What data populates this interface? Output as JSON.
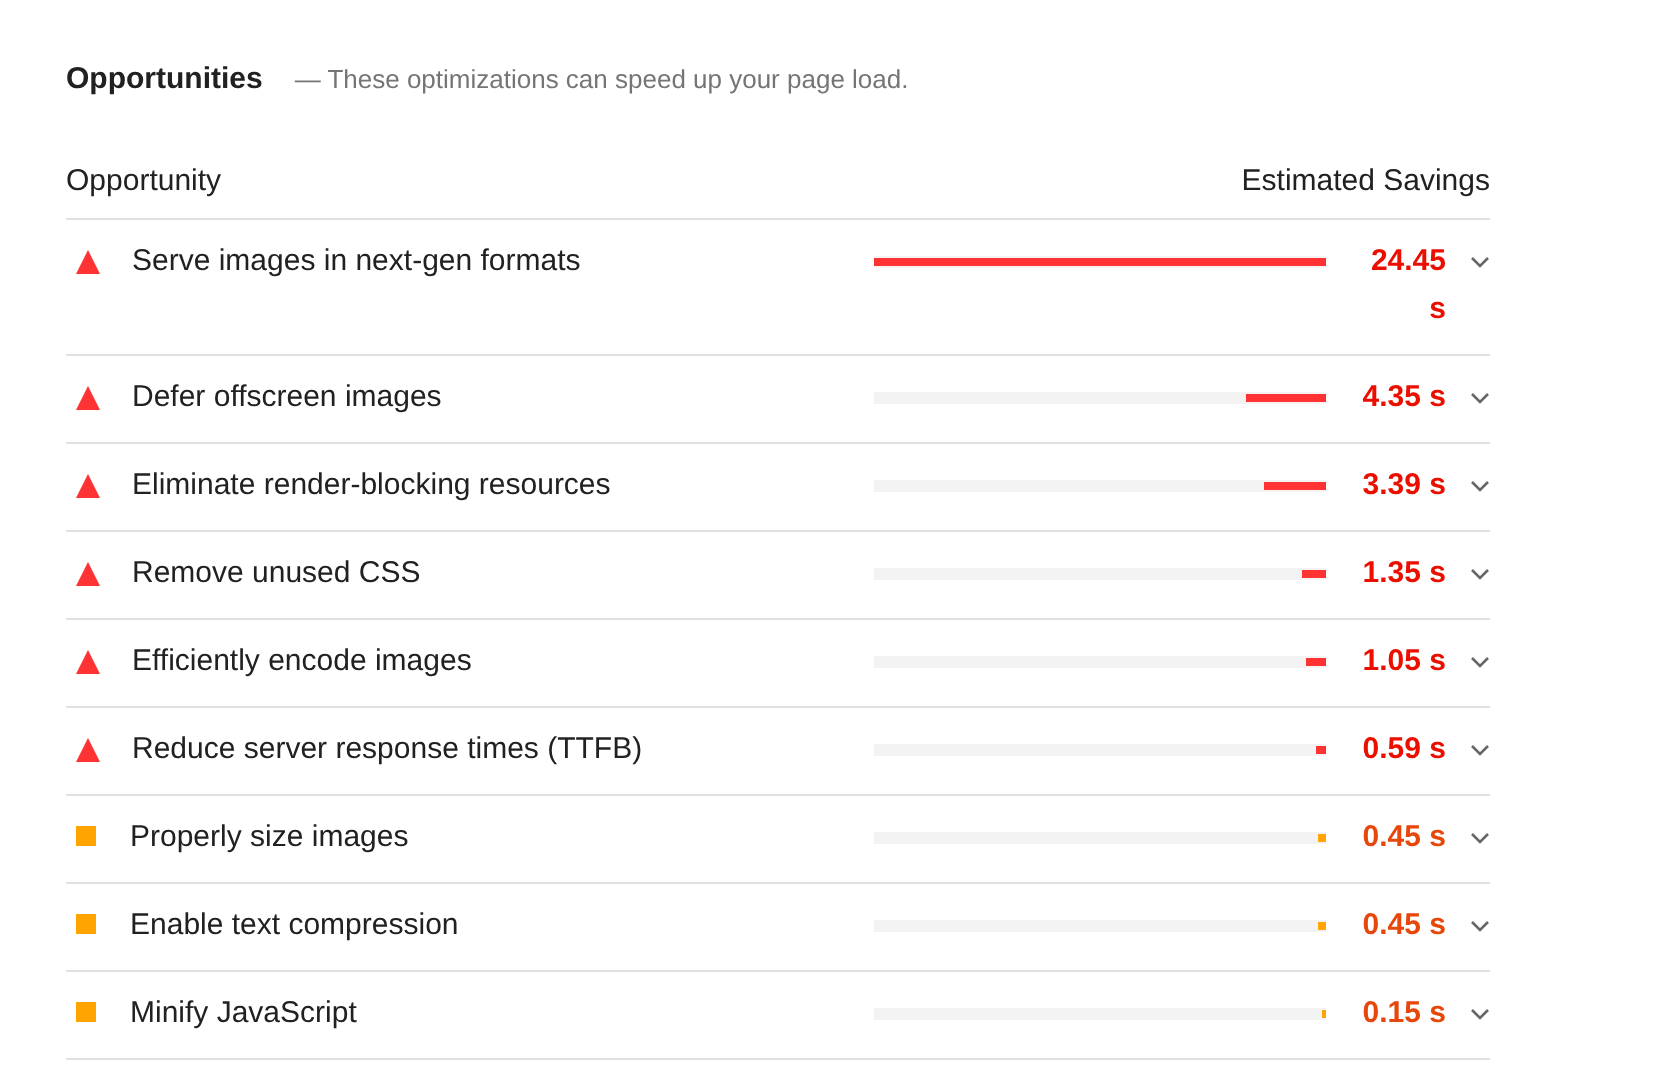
{
  "section": {
    "title": "Opportunities",
    "description": "— These optimizations can speed up your page load."
  },
  "table": {
    "columns": [
      "Opportunity",
      "Estimated Savings"
    ],
    "rows": [
      {
        "kind": "fail",
        "label": "Serve images in next-gen formats",
        "level": 1.0,
        "savings": "24.45 s"
      },
      {
        "kind": "fail",
        "label": "Defer offscreen images",
        "level": 0.178,
        "savings": "4.35 s"
      },
      {
        "kind": "fail",
        "label": "Eliminate render-blocking resources",
        "level": 0.139,
        "savings": "3.39 s"
      },
      {
        "kind": "fail",
        "label": "Remove unused CSS",
        "level": 0.055,
        "savings": "1.35 s"
      },
      {
        "kind": "fail",
        "label": "Efficiently encode images",
        "level": 0.043,
        "savings": "1.05 s"
      },
      {
        "kind": "fail",
        "label": "Reduce server response times (TTFB)",
        "level": 0.024,
        "savings": "0.59 s"
      },
      {
        "kind": "average",
        "label": "Properly size images",
        "level": 0.018,
        "savings": "0.45 s"
      },
      {
        "kind": "average",
        "label": "Enable text compression",
        "level": 0.018,
        "savings": "0.45 s"
      },
      {
        "kind": "average",
        "label": "Minify JavaScript",
        "level": 0.006,
        "savings": "0.15 s"
      }
    ]
  }
}
